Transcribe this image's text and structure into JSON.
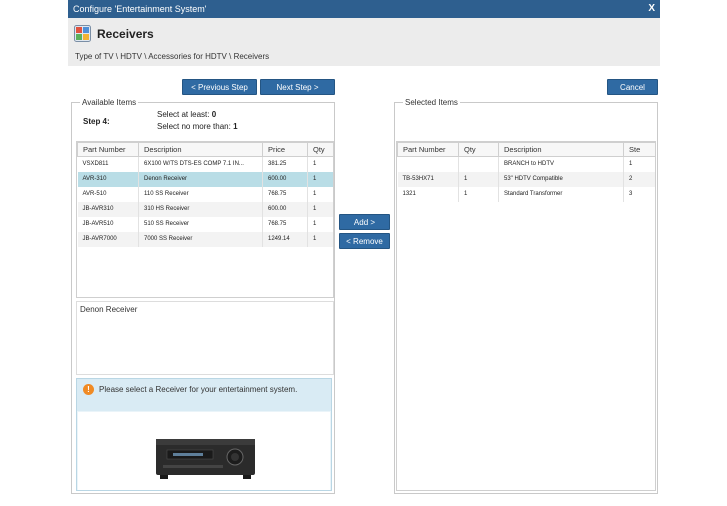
{
  "window": {
    "title": "Configure 'Entertainment System'",
    "close_label": "X"
  },
  "header": {
    "title": "Receivers",
    "breadcrumb": "Type of TV \\ HDTV \\ Accessories for HDTV \\ Receivers"
  },
  "buttons": {
    "previous": "< Previous Step",
    "next": "Next Step >",
    "cancel": "Cancel",
    "add": "Add >",
    "remove": "< Remove"
  },
  "available": {
    "legend": "Available Items",
    "step_label": "Step 4:",
    "select_at_least_label": "Select at least:",
    "select_at_least_value": "0",
    "select_no_more_label": "Select no more than:",
    "select_no_more_value": "1",
    "columns": [
      "Part Number",
      "Description",
      "Price",
      "Qty"
    ],
    "rows": [
      {
        "part": "VSXD811",
        "desc": "6X100 W/TS DTS-ES COMP 7.1 IN...",
        "price": "381.25",
        "qty": "1"
      },
      {
        "part": "AVR-310",
        "desc": "Denon Receiver",
        "price": "600.00",
        "qty": "1"
      },
      {
        "part": "AVR-510",
        "desc": "110 SS Receiver",
        "price": "768.75",
        "qty": "1"
      },
      {
        "part": "JB-AVR310",
        "desc": "310 HS Receiver",
        "price": "600.00",
        "qty": "1"
      },
      {
        "part": "JB-AVR510",
        "desc": "510 SS Receiver",
        "price": "768.75",
        "qty": "1"
      },
      {
        "part": "JB-AVR7000",
        "desc": "7000 SS Receiver",
        "price": "1249.14",
        "qty": "1"
      }
    ],
    "selected_row_index": 1,
    "description_text": "Denon Receiver",
    "message": "Please select a Receiver for your entertainment system."
  },
  "selected": {
    "legend": "Selected Items",
    "columns": [
      "Part Number",
      "Qty",
      "Description",
      "Ste"
    ],
    "rows": [
      {
        "part": "",
        "qty": "",
        "desc": "BRANCH to HDTV",
        "step": "1"
      },
      {
        "part": "TB-53HX71",
        "qty": "1",
        "desc": "53\" HDTV Compatible",
        "step": "2"
      },
      {
        "part": "1321",
        "qty": "1",
        "desc": "Standard Transformer",
        "step": "3"
      }
    ]
  },
  "colors": {
    "titlebar": "#2e5f8f",
    "button": "#2f6aa3",
    "selected_row": "#b9dde6",
    "warning": "#f08a24"
  },
  "icons": {
    "header": "receivers-category-icon",
    "message": "warning-icon",
    "product": "av-receiver-image"
  }
}
